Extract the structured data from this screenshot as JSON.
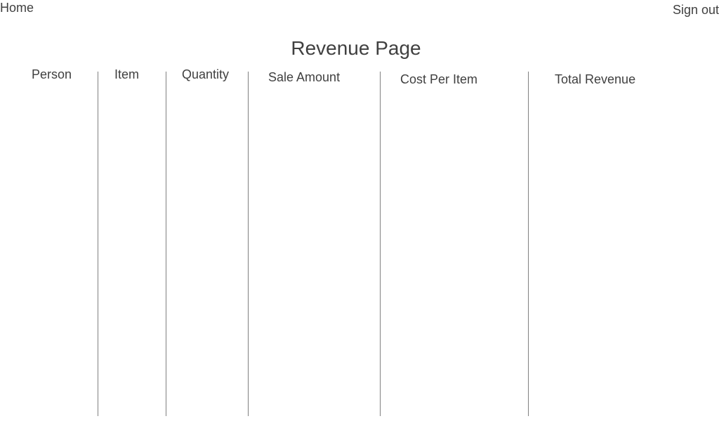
{
  "nav": {
    "home_label": "Home",
    "signout_label": "Sign out"
  },
  "page": {
    "title": "Revenue Page"
  },
  "table": {
    "columns": [
      {
        "label": "Person"
      },
      {
        "label": "Item"
      },
      {
        "label": "Quantity"
      },
      {
        "label": "Sale Amount"
      },
      {
        "label": "Cost Per Item"
      },
      {
        "label": "Total Revenue"
      }
    ]
  }
}
